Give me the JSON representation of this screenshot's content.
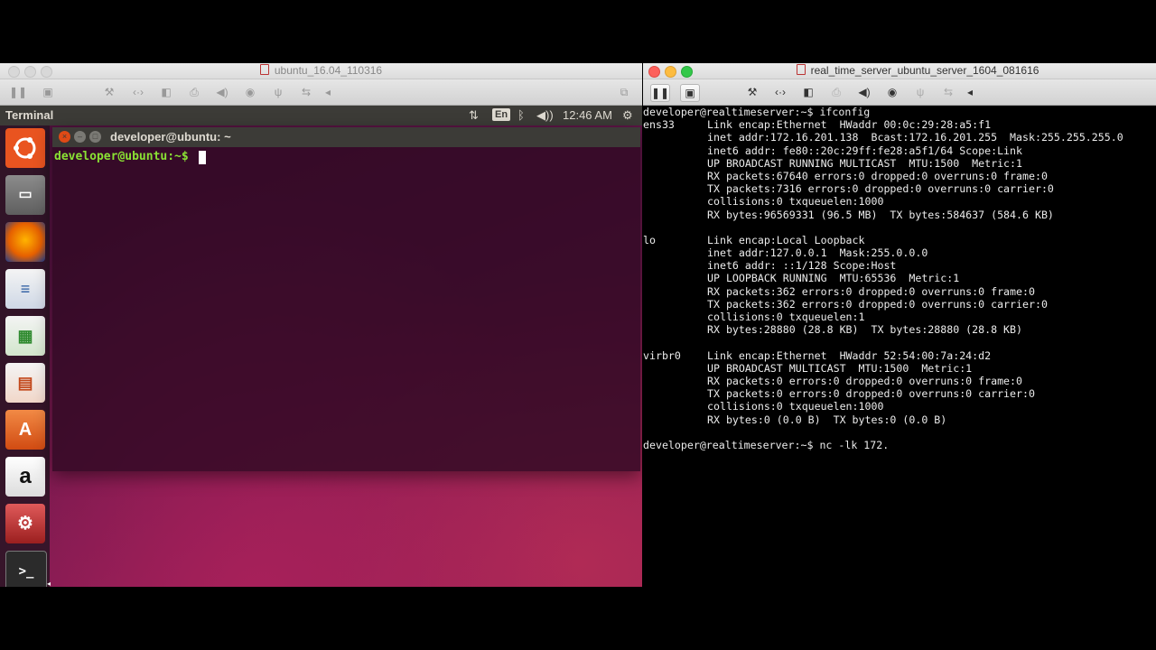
{
  "left_vm": {
    "window_title": "ubuntu_16.04_110316",
    "topbar": {
      "app_name": "Terminal",
      "lang": "En",
      "time": "12:46 AM"
    },
    "terminal": {
      "title": "developer@ubuntu: ~",
      "prompt": "developer@ubuntu:~$ "
    }
  },
  "right_vm": {
    "window_title": "real_time_server_ubuntu_server_1604_081616",
    "console": {
      "lines": [
        {
          "name": "",
          "text": "developer@realtimeserver:~$ ifconfig"
        },
        {
          "name": "ens33",
          "text": "Link encap:Ethernet  HWaddr 00:0c:29:28:a5:f1"
        },
        {
          "name": "",
          "text": "inet addr:172.16.201.138  Bcast:172.16.201.255  Mask:255.255.255.0"
        },
        {
          "name": "",
          "text": "inet6 addr: fe80::20c:29ff:fe28:a5f1/64 Scope:Link"
        },
        {
          "name": "",
          "text": "UP BROADCAST RUNNING MULTICAST  MTU:1500  Metric:1"
        },
        {
          "name": "",
          "text": "RX packets:67640 errors:0 dropped:0 overruns:0 frame:0"
        },
        {
          "name": "",
          "text": "TX packets:7316 errors:0 dropped:0 overruns:0 carrier:0"
        },
        {
          "name": "",
          "text": "collisions:0 txqueuelen:1000"
        },
        {
          "name": "",
          "text": "RX bytes:96569331 (96.5 MB)  TX bytes:584637 (584.6 KB)"
        },
        {
          "name": "",
          "text": ""
        },
        {
          "name": "lo",
          "text": "Link encap:Local Loopback"
        },
        {
          "name": "",
          "text": "inet addr:127.0.0.1  Mask:255.0.0.0"
        },
        {
          "name": "",
          "text": "inet6 addr: ::1/128 Scope:Host"
        },
        {
          "name": "",
          "text": "UP LOOPBACK RUNNING  MTU:65536  Metric:1"
        },
        {
          "name": "",
          "text": "RX packets:362 errors:0 dropped:0 overruns:0 frame:0"
        },
        {
          "name": "",
          "text": "TX packets:362 errors:0 dropped:0 overruns:0 carrier:0"
        },
        {
          "name": "",
          "text": "collisions:0 txqueuelen:1"
        },
        {
          "name": "",
          "text": "RX bytes:28880 (28.8 KB)  TX bytes:28880 (28.8 KB)"
        },
        {
          "name": "",
          "text": ""
        },
        {
          "name": "virbr0",
          "text": "Link encap:Ethernet  HWaddr 52:54:00:7a:24:d2"
        },
        {
          "name": "",
          "text": "UP BROADCAST MULTICAST  MTU:1500  Metric:1"
        },
        {
          "name": "",
          "text": "RX packets:0 errors:0 dropped:0 overruns:0 frame:0"
        },
        {
          "name": "",
          "text": "TX packets:0 errors:0 dropped:0 overruns:0 carrier:0"
        },
        {
          "name": "",
          "text": "collisions:0 txqueuelen:1000"
        },
        {
          "name": "",
          "text": "RX bytes:0 (0.0 B)  TX bytes:0 (0.0 B)"
        },
        {
          "name": "",
          "text": ""
        },
        {
          "name": "",
          "text": "developer@realtimeserver:~$ nc -lk 172."
        }
      ]
    }
  },
  "icons": {
    "pause": "pause-icon",
    "snapshot": "snapshot-icon",
    "settings": "wrench-icon",
    "network": "network-icon",
    "disk": "disk-icon",
    "printer": "printer-icon",
    "sound": "sound-icon",
    "camera": "camera-icon",
    "usb": "usb-icon",
    "share": "share-icon",
    "back": "chevron-left-icon",
    "fullscreen": "fullscreen-icon"
  },
  "colors": {
    "prompt_green": "#8ae234",
    "ubuntu_orange": "#e95420",
    "panel": "#3c3b37"
  }
}
